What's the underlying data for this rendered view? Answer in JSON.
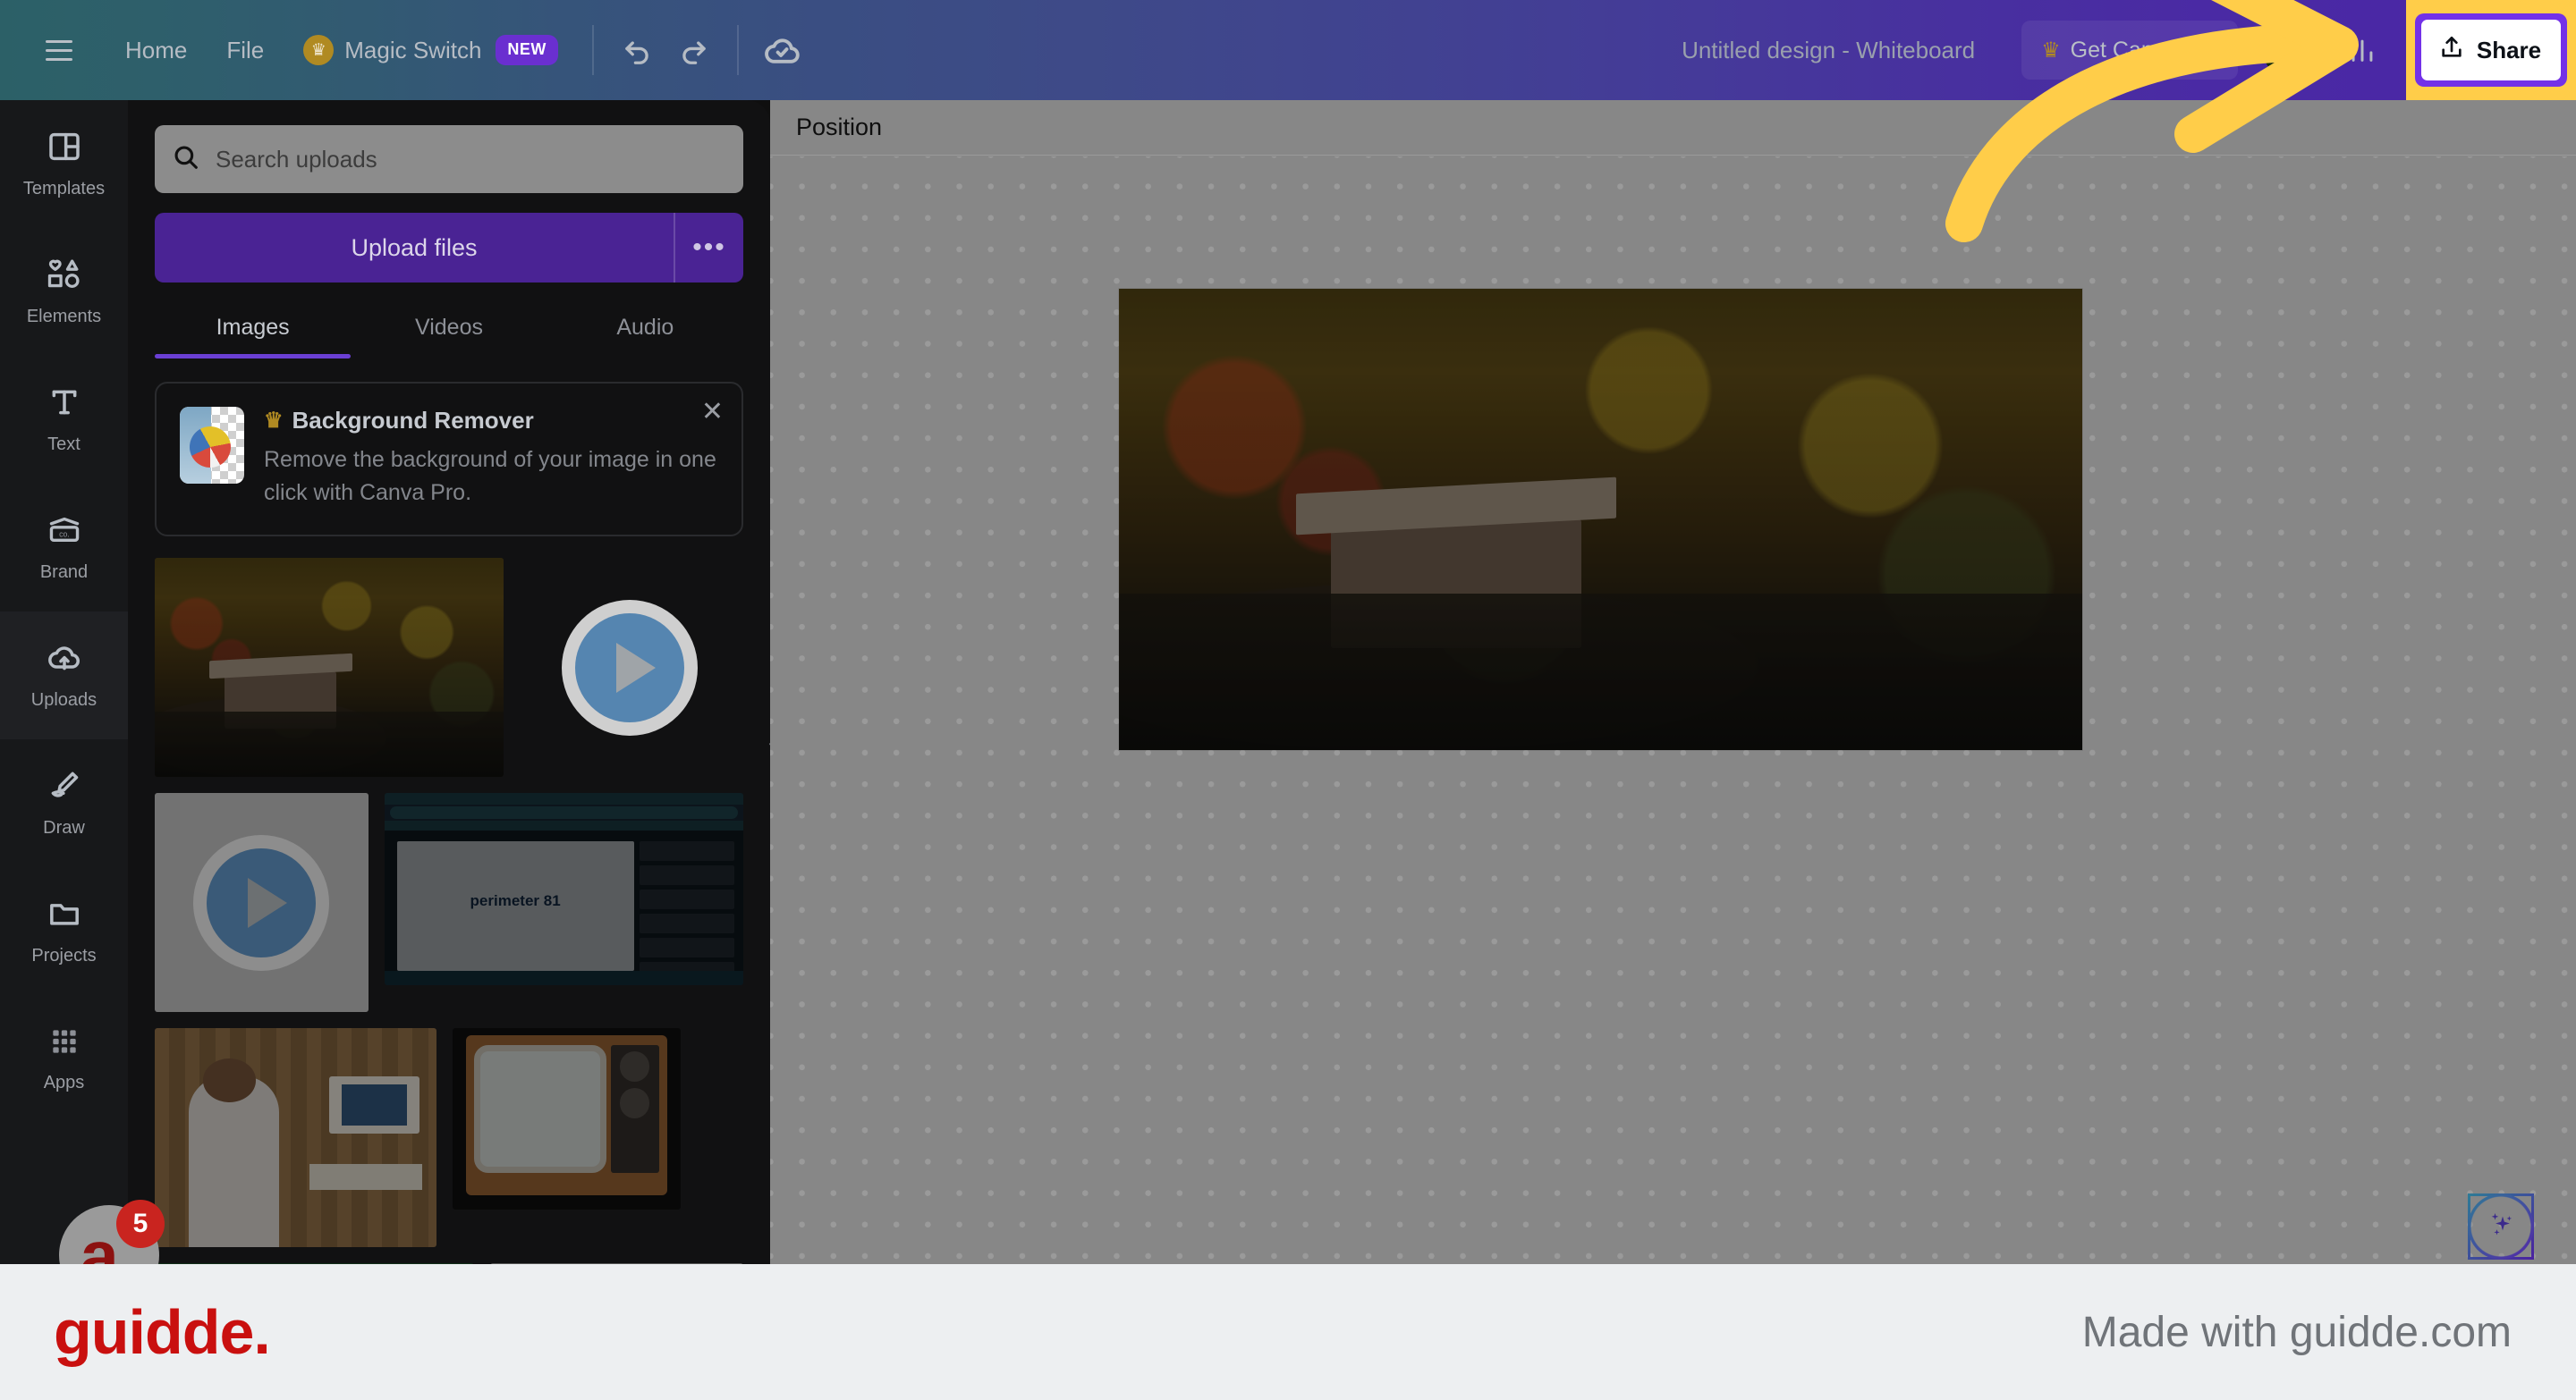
{
  "header": {
    "menu_icon": "hamburger-icon",
    "nav": [
      {
        "label": "Home",
        "icon": ""
      },
      {
        "label": "File",
        "icon": ""
      }
    ],
    "magic_switch": {
      "label": "Magic Switch",
      "badge": "NEW",
      "icon": "crown-icon"
    },
    "undo_icon": "undo-icon",
    "redo_icon": "redo-icon",
    "cloud_icon": "cloud-saved-icon",
    "design_title": "Untitled design - Whiteboard",
    "get_canva_pro": {
      "label": "Get Canva Pro",
      "icon": "crown-icon"
    },
    "avatar": "avatar",
    "insights_icon": "bar-chart-icon",
    "share": {
      "label": "Share",
      "icon": "share-upload-icon"
    },
    "colors": {
      "gradient_start": "#2c6067",
      "gradient_end": "#4b26a6",
      "badge_new_bg": "#6a2fd0",
      "crown": "#b08a22",
      "highlight_outer": "#ffcd49",
      "highlight_inner": "#7331e8"
    }
  },
  "rail": {
    "items": [
      {
        "label": "Templates",
        "icon": "templates-icon",
        "active": false
      },
      {
        "label": "Elements",
        "icon": "elements-icon",
        "active": false
      },
      {
        "label": "Text",
        "icon": "text-icon",
        "active": false
      },
      {
        "label": "Brand",
        "icon": "brand-icon",
        "active": false
      },
      {
        "label": "Uploads",
        "icon": "uploads-cloud-icon",
        "active": true
      },
      {
        "label": "Draw",
        "icon": "draw-pen-icon",
        "active": false
      },
      {
        "label": "Projects",
        "icon": "folder-icon",
        "active": false
      },
      {
        "label": "Apps",
        "icon": "apps-grid-icon",
        "active": false
      }
    ]
  },
  "panel": {
    "search": {
      "placeholder": "Search uploads",
      "value": "",
      "icon": "search-icon"
    },
    "upload_button": {
      "label": "Upload files"
    },
    "upload_more": {
      "label": "•••",
      "icon": "more-options-icon"
    },
    "tabs": [
      {
        "label": "Images",
        "active": true
      },
      {
        "label": "Videos",
        "active": false
      },
      {
        "label": "Audio",
        "active": false
      }
    ],
    "promo": {
      "title": "Background Remover",
      "description": "Remove the background of your image in one click with Canva Pro.",
      "crown_icon": "crown-icon",
      "close_icon": "close-icon",
      "thumb_icon": "beachball-transparency-icon"
    },
    "thumbnails": [
      {
        "name": "autumn-forest-cabin-photo",
        "type": "image"
      },
      {
        "name": "video-play-thumbnail",
        "type": "video"
      },
      {
        "name": "video-play-thumbnail-2",
        "type": "video"
      },
      {
        "name": "perimeter-81-youtube-screenshot",
        "type": "image",
        "caption": "perimeter 81"
      },
      {
        "name": "retro-computer-person-photo",
        "type": "image"
      },
      {
        "name": "vintage-television-photo",
        "type": "image"
      },
      {
        "name": "green-thumbnail",
        "type": "image"
      },
      {
        "name": "gray-thumbnail",
        "type": "image"
      }
    ],
    "collapse_icon": "chevron-left-icon"
  },
  "canvas": {
    "toolbar": {
      "position_label": "Position"
    },
    "artboard": {
      "name": "autumn-forest-cabin-photo"
    },
    "magic_button": {
      "icon": "magic-sparkles-icon"
    }
  },
  "annotation": {
    "arrow_color": "#ffcd49",
    "target": "share-button"
  },
  "guidde_badge": {
    "letter": "a.",
    "count": "5"
  },
  "footer": {
    "logo": "guidde.",
    "made_with": "Made with guidde.com",
    "logo_color": "#c9100f",
    "bg": "#edeff1"
  }
}
